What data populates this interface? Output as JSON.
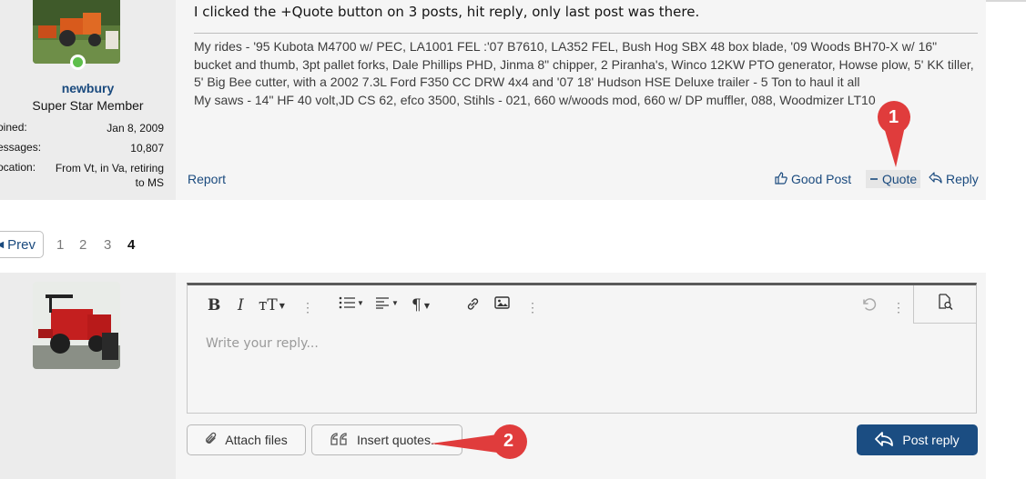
{
  "post": {
    "message": "I clicked the +Quote button on 3 posts, hit reply, only last post was there.",
    "signature": [
      "My rides - '95 Kubota M4700 w/ PEC, LA1001 FEL :'07 B7610, LA352 FEL, Bush Hog SBX 48 box blade, '09 Woods BH70-X w/ 16\"",
      "bucket and thumb, 3pt pallet forks, Dale Phillips PHD, Jinma 8\" chipper, 2 Piranha's, Winco 12KW PTO generator, Howse plow, 5' KK tiller,",
      "5' Big Bee cutter, with a 2002 7.3L Ford F350 CC DRW 4x4 and '07 18' Hudson HSE Deluxe trailer - 5 Ton to haul it all",
      "My saws - 14\" HF 40 volt,JD CS 62, efco 3500, Stihls - 021, 660 w/woods mod, 660 w/ DP muffler, 088, Woodmizer LT10"
    ],
    "actions": {
      "report": "Report",
      "good_post": "Good Post",
      "quote": "Quote",
      "reply": "Reply"
    }
  },
  "user": {
    "name": "newbury",
    "title": "Super Star Member",
    "stats": [
      {
        "key": "oined:",
        "value": "Jan 8, 2009"
      },
      {
        "key": "essages:",
        "value": "10,807"
      },
      {
        "key": "ocation:",
        "value": "From Vt, in Va, retiring to MS"
      }
    ]
  },
  "pagination": {
    "prev": "Prev",
    "pages": [
      "1",
      "2",
      "3",
      "4"
    ],
    "current": "4"
  },
  "editor": {
    "placeholder": "Write your reply...",
    "toolbar_icons": [
      "bold-icon",
      "italic-icon",
      "text-size-icon",
      "more-icon",
      "list-icon",
      "align-icon",
      "paragraph-icon",
      "link-icon",
      "image-icon",
      "more-icon",
      "undo-icon",
      "more-icon",
      "preview-icon"
    ]
  },
  "buttons": {
    "attach": "Attach files",
    "insert_quotes": "Insert quotes...",
    "post_reply": "Post reply"
  },
  "annotations": {
    "marker1": "1",
    "marker2": "2",
    "marker_color": "#e03c3c"
  }
}
